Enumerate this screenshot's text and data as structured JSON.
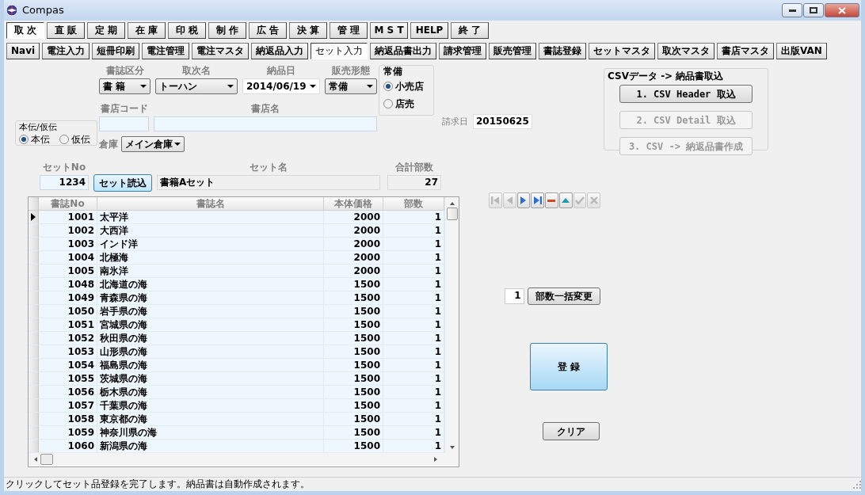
{
  "window": {
    "title": "Compas"
  },
  "main_menu": [
    {
      "label": "取 次",
      "selected": true
    },
    {
      "label": "直 販",
      "selected": false
    },
    {
      "label": "定 期",
      "selected": false
    },
    {
      "label": "在 庫",
      "selected": false
    },
    {
      "label": "印 税",
      "selected": false
    },
    {
      "label": "制 作",
      "selected": false
    },
    {
      "label": "広 告",
      "selected": false
    },
    {
      "label": "決 算",
      "selected": false
    },
    {
      "label": "管 理",
      "selected": false
    },
    {
      "label": "M S T",
      "selected": false
    },
    {
      "label": "HELP",
      "selected": false
    },
    {
      "label": "終 了",
      "selected": false
    }
  ],
  "sub_menu": [
    {
      "label": "Navi",
      "selected": false
    },
    {
      "label": "電注入力",
      "selected": false
    },
    {
      "label": "短冊印刷",
      "selected": false
    },
    {
      "label": "電注管理",
      "selected": false
    },
    {
      "label": "電注マスタ",
      "selected": false
    },
    {
      "label": "納返品入力",
      "selected": false
    },
    {
      "label": "セット入力",
      "selected": true
    },
    {
      "label": "納返品書出力",
      "selected": false
    },
    {
      "label": "請求管理",
      "selected": false
    },
    {
      "label": "販売管理",
      "selected": false
    },
    {
      "label": "書誌登録",
      "selected": false
    },
    {
      "label": "セットマスタ",
      "selected": false
    },
    {
      "label": "取次マスタ",
      "selected": false
    },
    {
      "label": "書店マスタ",
      "selected": false
    },
    {
      "label": "出版VAN",
      "selected": false
    }
  ],
  "header": {
    "book_category": {
      "label": "書誌区分",
      "value": "書 籍"
    },
    "distributor": {
      "label": "取次名",
      "value": "トーハン"
    },
    "delivery_date": {
      "label": "納品日",
      "value": "2014/06/19"
    },
    "sales_type": {
      "label": "販売形態",
      "value": "常備"
    },
    "store_code": {
      "label": "書店コード"
    },
    "store_name": {
      "label": "書店名"
    },
    "warehouse": {
      "label": "倉庫",
      "value": "メイン倉庫"
    },
    "billing_date": {
      "label": "請求日",
      "value": "20150625"
    }
  },
  "standing_group": {
    "title": "常備",
    "options": [
      {
        "label": "小売店",
        "selected": true
      },
      {
        "label": "店売",
        "selected": false
      }
    ]
  },
  "slip_group": {
    "title": "本伝/仮伝",
    "options": [
      {
        "label": "本伝",
        "selected": true
      },
      {
        "label": "仮伝",
        "selected": false
      }
    ]
  },
  "set": {
    "no_label": "セットNo",
    "no": "1234",
    "load_button": "セット読込",
    "name_label": "セット名",
    "name": "書籍Aセット",
    "total_label": "合計部数",
    "total": "27"
  },
  "grid": {
    "columns": [
      "書誌No",
      "書誌名",
      "本体価格",
      "部数"
    ],
    "rows": [
      {
        "no": "1001",
        "title": "太平洋",
        "price": "2000",
        "qty": "1",
        "current": true
      },
      {
        "no": "1002",
        "title": "大西洋",
        "price": "2000",
        "qty": "1",
        "current": false
      },
      {
        "no": "1003",
        "title": "インド洋",
        "price": "2000",
        "qty": "1",
        "current": false
      },
      {
        "no": "1004",
        "title": "北極海",
        "price": "2000",
        "qty": "1",
        "current": false
      },
      {
        "no": "1005",
        "title": "南氷洋",
        "price": "2000",
        "qty": "1",
        "current": false
      },
      {
        "no": "1048",
        "title": "北海道の海",
        "price": "1500",
        "qty": "1",
        "current": false
      },
      {
        "no": "1049",
        "title": "青森県の海",
        "price": "1500",
        "qty": "1",
        "current": false
      },
      {
        "no": "1050",
        "title": "岩手県の海",
        "price": "1500",
        "qty": "1",
        "current": false
      },
      {
        "no": "1051",
        "title": "宮城県の海",
        "price": "1500",
        "qty": "1",
        "current": false
      },
      {
        "no": "1052",
        "title": "秋田県の海",
        "price": "1500",
        "qty": "1",
        "current": false
      },
      {
        "no": "1053",
        "title": "山形県の海",
        "price": "1500",
        "qty": "1",
        "current": false
      },
      {
        "no": "1054",
        "title": "福島県の海",
        "price": "1500",
        "qty": "1",
        "current": false
      },
      {
        "no": "1055",
        "title": "茨城県の海",
        "price": "1500",
        "qty": "1",
        "current": false
      },
      {
        "no": "1056",
        "title": "栃木県の海",
        "price": "1500",
        "qty": "1",
        "current": false
      },
      {
        "no": "1057",
        "title": "千葉県の海",
        "price": "1500",
        "qty": "1",
        "current": false
      },
      {
        "no": "1058",
        "title": "東京都の海",
        "price": "1500",
        "qty": "1",
        "current": false
      },
      {
        "no": "1059",
        "title": "神奈川県の海",
        "price": "1500",
        "qty": "1",
        "current": false
      },
      {
        "no": "1060",
        "title": "新潟県の海",
        "price": "1500",
        "qty": "1",
        "current": false
      }
    ]
  },
  "navigator": [
    {
      "kind": "first",
      "disabled": true
    },
    {
      "kind": "prev",
      "disabled": true
    },
    {
      "kind": "next",
      "disabled": false
    },
    {
      "kind": "last",
      "disabled": false
    },
    {
      "kind": "delete",
      "disabled": false
    },
    {
      "kind": "edit",
      "disabled": false
    },
    {
      "kind": "post",
      "disabled": true
    },
    {
      "kind": "cancel",
      "disabled": true
    }
  ],
  "bulk": {
    "value": "1",
    "button": "部数一括変更"
  },
  "register_button": "登 録",
  "clear_button": "クリア",
  "csv_group": {
    "title": "CSVデータ -> 納品書取込",
    "buttons": [
      {
        "label": "1. CSV Header 取込",
        "disabled": false
      },
      {
        "label": "2. CSV Detail 取込",
        "disabled": true
      },
      {
        "label": "3. CSV -> 納返品書作成",
        "disabled": true
      }
    ]
  },
  "status_bar": "クリックしてセット品登録を完了します。納品書は自動作成されます。"
}
